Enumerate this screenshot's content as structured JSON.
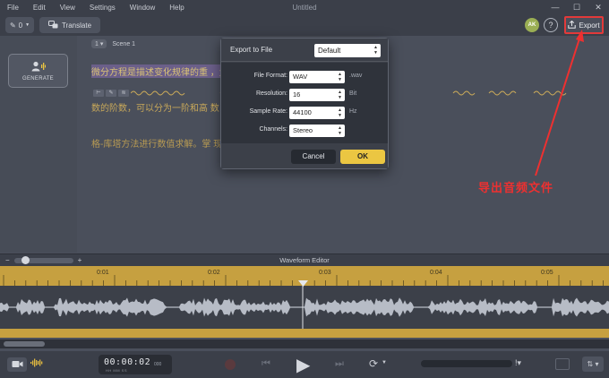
{
  "window": {
    "title": "Untitled",
    "menus": [
      "File",
      "Edit",
      "View",
      "Settings",
      "Window",
      "Help"
    ],
    "controls": [
      "—",
      "☐",
      "✕"
    ]
  },
  "toolbar": {
    "edit_count": "0",
    "translate_label": "Translate",
    "avatar_initials": "AK",
    "help_label": "?",
    "export_label": "Export"
  },
  "left_panel": {
    "generate_label": "GENERATE"
  },
  "script": {
    "scene_number": "1",
    "scene_label": "Scene 1",
    "lines": [
      "微分方程是描述变化规律的重 ，量以及导数之间的关系。它在物理学中用",
      "数的阶数，可以分为一阶和高 数，又划分为常微分方程和偏微分方程等",
      "格-库塔方法进行数值求解。掌 现实世界中各种动态系统的演变规律。"
    ]
  },
  "dialog": {
    "title": "Export to File",
    "preset": "Default",
    "fields": [
      {
        "label": "File Format:",
        "value": "WAV",
        "unit": ".wav"
      },
      {
        "label": "Resolution:",
        "value": "16",
        "unit": "Bit"
      },
      {
        "label": "Sample Rate:",
        "value": "44100",
        "unit": "Hz"
      },
      {
        "label": "Channels:",
        "value": "Stereo",
        "unit": ""
      }
    ],
    "cancel_label": "Cancel",
    "ok_label": "OK"
  },
  "annotation": {
    "text": "导出音频文件",
    "color": "#ee3030"
  },
  "waveform": {
    "title": "Waveform Editor",
    "zoom_minus": "−",
    "zoom_plus": "+",
    "ruler_ticks": [
      "0:01",
      "0:02",
      "0:03",
      "0:04",
      "0:05"
    ]
  },
  "transport": {
    "timecode": "00:00:02",
    "timecode_sub": "HH  MM  SS",
    "timecode_ms": "000"
  },
  "colors": {
    "accent": "#ebc642",
    "highlight": "#e23a3a",
    "ruler": "#c6a040"
  }
}
